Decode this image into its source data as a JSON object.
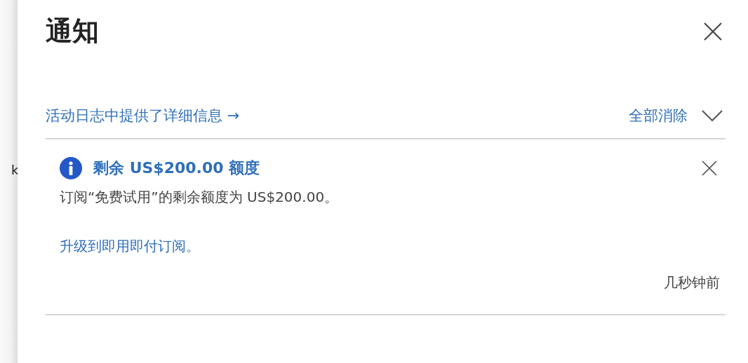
{
  "background_text": "k",
  "panel": {
    "title": "通知",
    "activity_link": "活动日志中提供了详细信息 →",
    "dismiss_all": "全部消除",
    "notifications": [
      {
        "kind": "info",
        "title": "剩余 US$200.00 额度",
        "body": "订阅“免费试用”的剩余额度为 US$200.00。",
        "link": "升级到即用即付订阅。",
        "time": "几秒钟前"
      }
    ]
  }
}
